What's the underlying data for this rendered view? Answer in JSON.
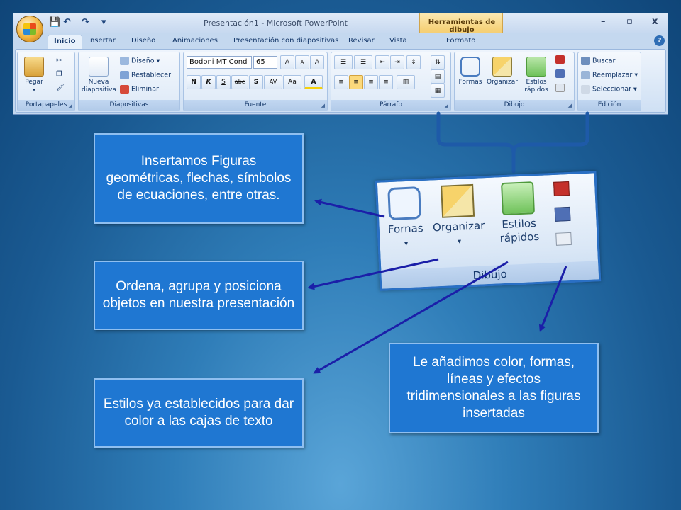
{
  "window": {
    "title": "Presentación1 - Microsoft PowerPoint",
    "contextual_tab_group": "Herramientas de dibujo",
    "minimize": "–",
    "restore": "▫",
    "close": "x",
    "quick_access": {
      "save": "💾",
      "undo": "↶",
      "redo": "↷",
      "more": "▾"
    }
  },
  "tabs": [
    "Inicio",
    "Insertar",
    "Diseño",
    "Animaciones",
    "Presentación con diapositivas",
    "Revisar",
    "Vista",
    "Formato"
  ],
  "help": "?",
  "ribbon": {
    "portapapeles": {
      "label": "Portapapeles",
      "paste": "Pegar",
      "cut": "✂",
      "copy": "❐",
      "format_painter": "🖌"
    },
    "diapositivas": {
      "label": "Diapositivas",
      "new_slide": "Nueva diapositiva",
      "layout": "Diseño",
      "reset": "Restablecer",
      "delete": "Eliminar"
    },
    "fuente": {
      "label": "Fuente",
      "font_name": "Bodoni MT Cond",
      "font_size": "65",
      "grow": "A",
      "shrink": "A",
      "clear": "A",
      "bold": "N",
      "italic": "K",
      "underline": "S",
      "strike": "abc",
      "shadow": "S",
      "spacing": "AV",
      "case": "Aa",
      "color": "A"
    },
    "parrafo": {
      "label": "Párrafo"
    },
    "dibujo": {
      "label": "Dibujo",
      "shapes": "Formas",
      "arrange": "Organizar",
      "quick_styles": "Estilos rápidos"
    },
    "edicion": {
      "label": "Edición",
      "find": "Buscar",
      "replace": "Reemplazar",
      "select": "Seleccionar"
    }
  },
  "zoom": {
    "shapes": "Fornas",
    "arrange": "Organizar",
    "quick_styles": "Estilos rápidos",
    "group": "Dibujo"
  },
  "callouts": {
    "shapes": "Insertamos Figuras geométricas, flechas, símbolos de ecuaciones, entre otras.",
    "arrange": "Ordena, agrupa y posiciona objetos en nuestra presentación",
    "styles": "Estilos ya establecidos para dar color a las cajas de texto",
    "format": "Le añadimos color, formas, líneas y efectos tridimensionales a las figuras insertadas"
  },
  "colors": {
    "callout_bg": "#1f77d2",
    "arrow": "#1b1fa8",
    "bracket": "#1e5aa8"
  }
}
